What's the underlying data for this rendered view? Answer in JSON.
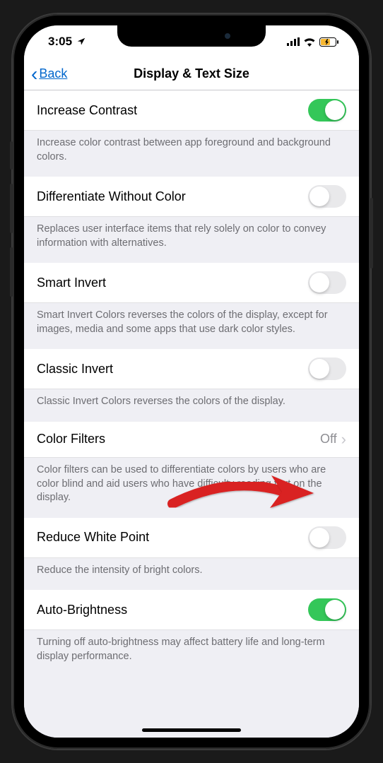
{
  "status": {
    "time": "3:05",
    "location_icon": "location-arrow",
    "signal_icon": "cellular-bars",
    "wifi_icon": "wifi",
    "battery_icon": "battery-charging"
  },
  "nav": {
    "back_label": "Back",
    "title": "Display & Text Size"
  },
  "sections": [
    {
      "label": "Increase Contrast",
      "type": "toggle",
      "value": true,
      "footer": "Increase color contrast between app foreground and background colors."
    },
    {
      "label": "Differentiate Without Color",
      "type": "toggle",
      "value": false,
      "footer": "Replaces user interface items that rely solely on color to convey information with alternatives."
    },
    {
      "label": "Smart Invert",
      "type": "toggle",
      "value": false,
      "footer": "Smart Invert Colors reverses the colors of the display, except for images, media and some apps that use dark color styles."
    },
    {
      "label": "Classic Invert",
      "type": "toggle",
      "value": false,
      "footer": "Classic Invert Colors reverses the colors of the display."
    },
    {
      "label": "Color Filters",
      "type": "link",
      "value_text": "Off",
      "footer": "Color filters can be used to differentiate colors by users who are color blind and aid users who have difficulty reading text on the display."
    },
    {
      "label": "Reduce White Point",
      "type": "toggle",
      "value": false,
      "footer": "Reduce the intensity of bright colors."
    },
    {
      "label": "Auto-Brightness",
      "type": "toggle",
      "value": true,
      "footer": "Turning off auto-brightness may affect battery life and long-term display performance."
    }
  ],
  "annotation": {
    "arrow_color": "#d92020"
  }
}
